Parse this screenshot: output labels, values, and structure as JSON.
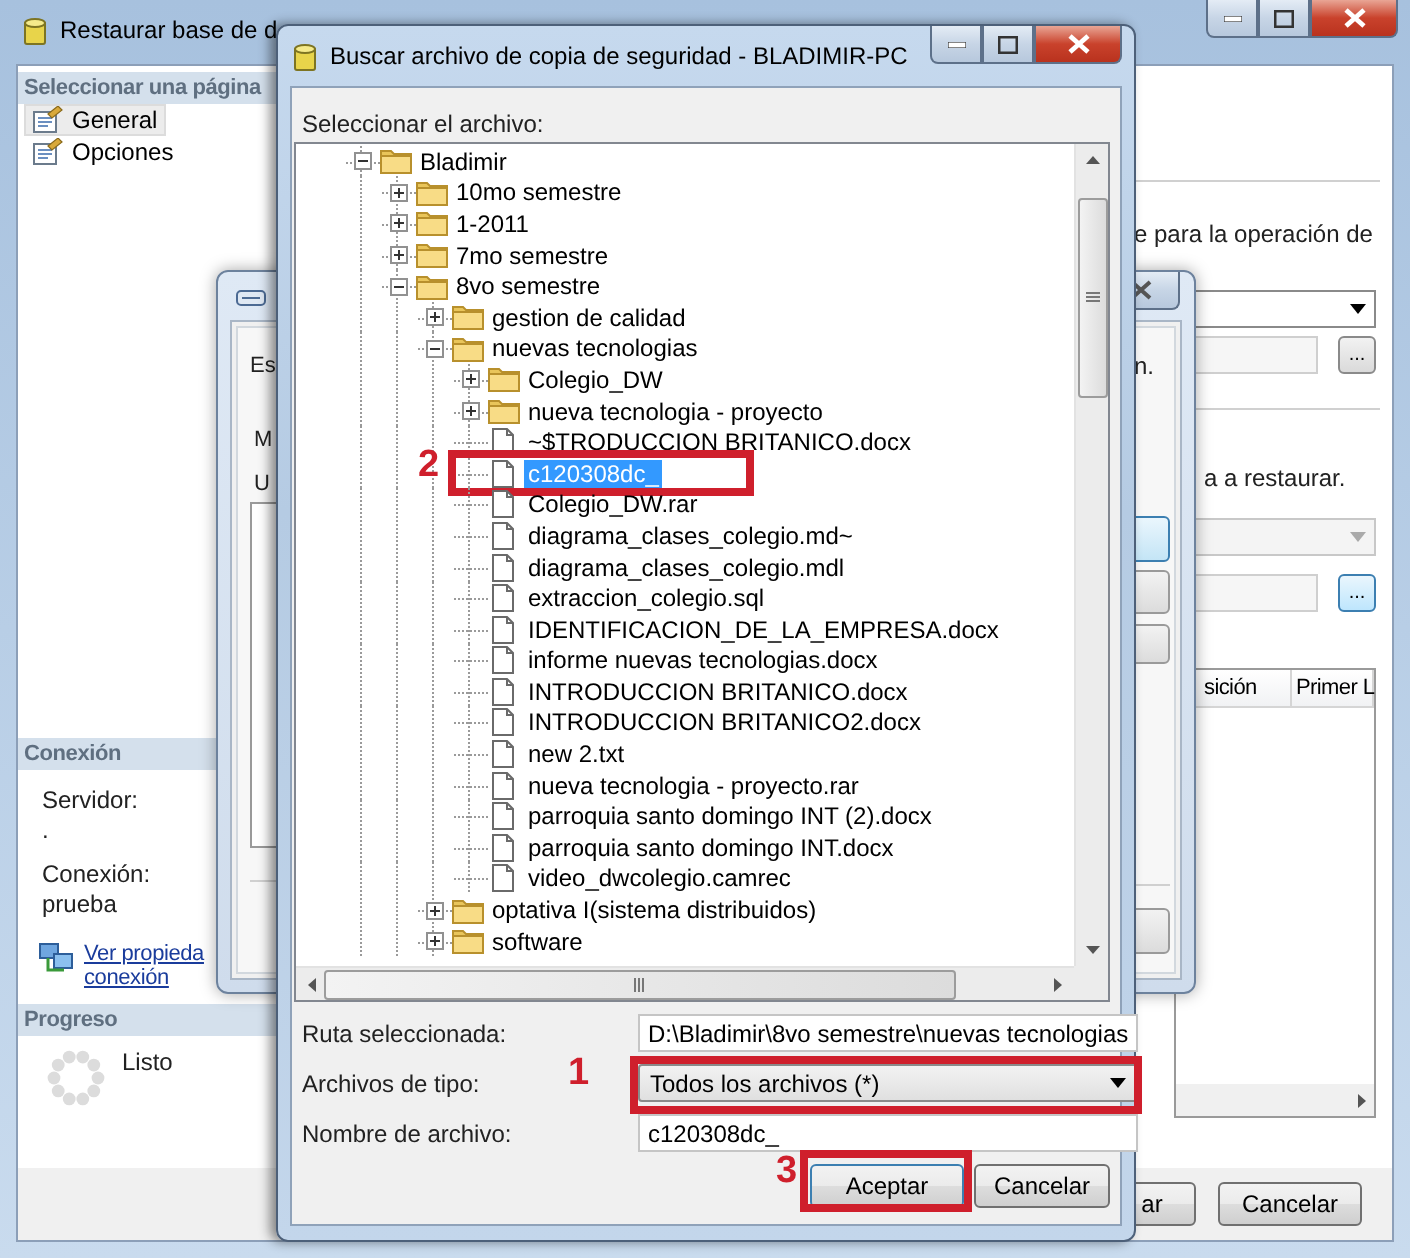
{
  "main_window": {
    "title": "Restaurar base de d",
    "sidebar": {
      "pages_header": "Seleccionar una página",
      "pages": [
        {
          "label": "General",
          "selected": true
        },
        {
          "label": "Opciones",
          "selected": false
        }
      ],
      "connection_header": "Conexión",
      "server_label": "Servidor:",
      "server_value": ".",
      "connection_label": "Conexión:",
      "connection_value": "prueba",
      "links": [
        "Ver propieda",
        "conexión"
      ],
      "progress_header": "Progreso",
      "progress_status": "Listo"
    },
    "content": {
      "source_text": "e para la operación de",
      "restore_text": "a a restaurar.",
      "browse_buttons": [
        "...",
        "..."
      ],
      "table_columns": [
        "sición",
        "Primer L"
      ],
      "buttons": [
        "ar",
        "Cancelar"
      ]
    }
  },
  "middle_window": {
    "left_texts": [
      "Es",
      "M",
      "U"
    ],
    "right_text": "n."
  },
  "file_dialog": {
    "title": "Buscar archivo de copia de seguridad - BLADIMIR-PC",
    "tree_label": "Seleccionar el archivo:",
    "tree": [
      {
        "name": "Bladimir",
        "kind": "folder",
        "expanded": true,
        "selected": false,
        "children": [
          {
            "name": "10mo semestre",
            "kind": "folder",
            "expanded": false,
            "selected": false
          },
          {
            "name": "1-2011",
            "kind": "folder",
            "expanded": false,
            "selected": false
          },
          {
            "name": "7mo semestre",
            "kind": "folder",
            "expanded": false,
            "selected": false
          },
          {
            "name": "8vo semestre",
            "kind": "folder",
            "expanded": true,
            "selected": false,
            "children": [
              {
                "name": "gestion de calidad",
                "kind": "folder",
                "expanded": false,
                "selected": false
              },
              {
                "name": "nuevas tecnologias",
                "kind": "folder",
                "expanded": true,
                "selected": false,
                "children": [
                  {
                    "name": "Colegio_DW",
                    "kind": "folder",
                    "expanded": false,
                    "selected": false
                  },
                  {
                    "name": "nueva tecnologia - proyecto",
                    "kind": "folder",
                    "expanded": false,
                    "selected": false
                  },
                  {
                    "name": "~$TRODUCCION BRITANICO.docx",
                    "kind": "file",
                    "selected": false
                  },
                  {
                    "name": "c120308dc_",
                    "kind": "file",
                    "selected": true,
                    "annotation": "2"
                  },
                  {
                    "name": "Colegio_DW.rar",
                    "kind": "file",
                    "selected": false
                  },
                  {
                    "name": "diagrama_clases_colegio.md~",
                    "kind": "file",
                    "selected": false
                  },
                  {
                    "name": "diagrama_clases_colegio.mdl",
                    "kind": "file",
                    "selected": false
                  },
                  {
                    "name": "extraccion_colegio.sql",
                    "kind": "file",
                    "selected": false
                  },
                  {
                    "name": "IDENTIFICACION_DE_LA_EMPRESA.docx",
                    "kind": "file",
                    "selected": false
                  },
                  {
                    "name": "informe nuevas tecnologias.docx",
                    "kind": "file",
                    "selected": false
                  },
                  {
                    "name": "INTRODUCCION BRITANICO.docx",
                    "kind": "file",
                    "selected": false
                  },
                  {
                    "name": "INTRODUCCION BRITANICO2.docx",
                    "kind": "file",
                    "selected": false
                  },
                  {
                    "name": "new  2.txt",
                    "kind": "file",
                    "selected": false
                  },
                  {
                    "name": "nueva tecnologia - proyecto.rar",
                    "kind": "file",
                    "selected": false
                  },
                  {
                    "name": "parroquia santo domingo INT (2).docx",
                    "kind": "file",
                    "selected": false
                  },
                  {
                    "name": "parroquia santo domingo INT.docx",
                    "kind": "file",
                    "selected": false
                  },
                  {
                    "name": "video_dwcolegio.camrec",
                    "kind": "file",
                    "selected": false
                  }
                ]
              },
              {
                "name": "optativa I(sistema distribuidos)",
                "kind": "folder",
                "expanded": false,
                "selected": false
              },
              {
                "name": "software",
                "kind": "folder",
                "expanded": false,
                "selected": false
              }
            ]
          }
        ]
      }
    ],
    "selected_path_label": "Ruta seleccionada:",
    "selected_path": "D:\\Bladimir\\8vo semestre\\nuevas tecnologias",
    "file_type_label": "Archivos de tipo:",
    "file_type": "Todos los archivos (*)",
    "file_type_annotation": "1",
    "file_name_label": "Nombre de archivo:",
    "file_name": "c120308dc_",
    "buttons": [
      {
        "label": "Aceptar",
        "annotation": "3"
      },
      {
        "label": "Cancelar"
      }
    ]
  }
}
